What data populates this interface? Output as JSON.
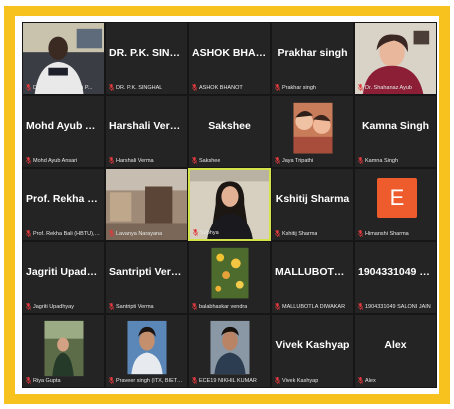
{
  "meeting": {
    "participants": [
      {
        "display": "",
        "label": "Director BIET Jhansi P...",
        "video": "video-person-director"
      },
      {
        "display": "DR. P.K. SINGHAL",
        "label": "DR. P.K. SINGHAL"
      },
      {
        "display": "ASHOK BHANOT",
        "label": "ASHOK BHANOT"
      },
      {
        "display": "Prakhar singh",
        "label": "Prakhar singh"
      },
      {
        "display": "",
        "label": "Dr. Shahanaz Ayub",
        "video": "video-person-shahanaz"
      },
      {
        "display": "Mohd Ayub An...",
        "label": "Mohd Ayub Ansari"
      },
      {
        "display": "Harshali Verma",
        "label": "Harshali Verma"
      },
      {
        "display": "Sakshee",
        "label": "Sakshee"
      },
      {
        "display": "",
        "label": "Jaya Tripathi",
        "video": "video-jaya"
      },
      {
        "display": "Kamna Singh",
        "label": "Kamna Singh"
      },
      {
        "display": "Prof. Rekha Ball...",
        "label": "Prof. Rekha Bali (HBTU), K..."
      },
      {
        "display": "",
        "label": "Lavanya Narayana",
        "video": "video-room"
      },
      {
        "display": "",
        "label": "Sabhya",
        "video": "video-sabhya",
        "active": true
      },
      {
        "display": "Kshitij Sharma",
        "label": "Kshitij Sharma"
      },
      {
        "display": "",
        "label": "Himanshi Sharma",
        "avatar_letter": "E",
        "avatar_color": "#ee5b2c"
      },
      {
        "display": "Jagriti Upadhyay",
        "label": "Jagriti Upadhyay"
      },
      {
        "display": "Santripti Verma",
        "label": "Santripti Verma"
      },
      {
        "display": "",
        "label": "balabhaskar vendra",
        "video": "video-flowers"
      },
      {
        "display": "MALLUBOTLA...",
        "label": "MALLUBOTLA DIWAKAR"
      },
      {
        "display": "1904331049 SA...",
        "label": "1904331049 SALONI JAIN"
      },
      {
        "display": "",
        "label": "Riya Gupta",
        "video": "video-riya"
      },
      {
        "display": "",
        "label": "Praveer singh (ITX, BIET J...",
        "video": "video-praveer"
      },
      {
        "display": "",
        "label": "ECE19 NIKHIL KUMAR",
        "video": "video-nikhil"
      },
      {
        "display": "Vivek Kashyap",
        "label": "Vivek Kashyap"
      },
      {
        "display": "Alex",
        "label": "Alex"
      }
    ]
  },
  "colors": {
    "frame": "#f7c21d",
    "tile_bg": "#242424",
    "active_border": "#d4e34a",
    "mic_muted": "#e0393e"
  }
}
